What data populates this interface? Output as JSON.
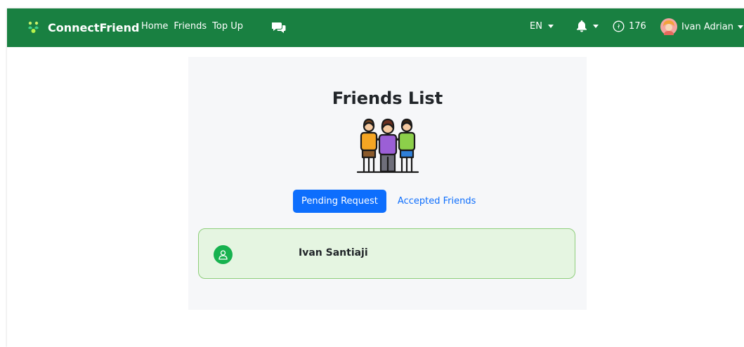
{
  "navbar": {
    "brand": "ConnectFriend",
    "links": [
      "Home",
      "Friends",
      "Top Up"
    ],
    "chat_icon": "chat-bubbles-icon",
    "language": "EN",
    "notification_icon": "bell-icon",
    "points_icon": "coin-icon",
    "points": "176",
    "user_name": "Ivan Adrian",
    "background_color": "#198041"
  },
  "main": {
    "title": "Friends List",
    "hero_icon": "friends-group-icon",
    "tabs": {
      "pending": "Pending Request",
      "accepted": "Accepted Friends"
    },
    "friends": [
      {
        "name": "Ivan Santiaji",
        "icon": "user-icon"
      }
    ]
  },
  "colors": {
    "primary": "#0d6efd",
    "friend_card_bg": "#e5f5e1",
    "friend_card_border": "#8fce7c",
    "avatar_green": "#17b24f"
  }
}
